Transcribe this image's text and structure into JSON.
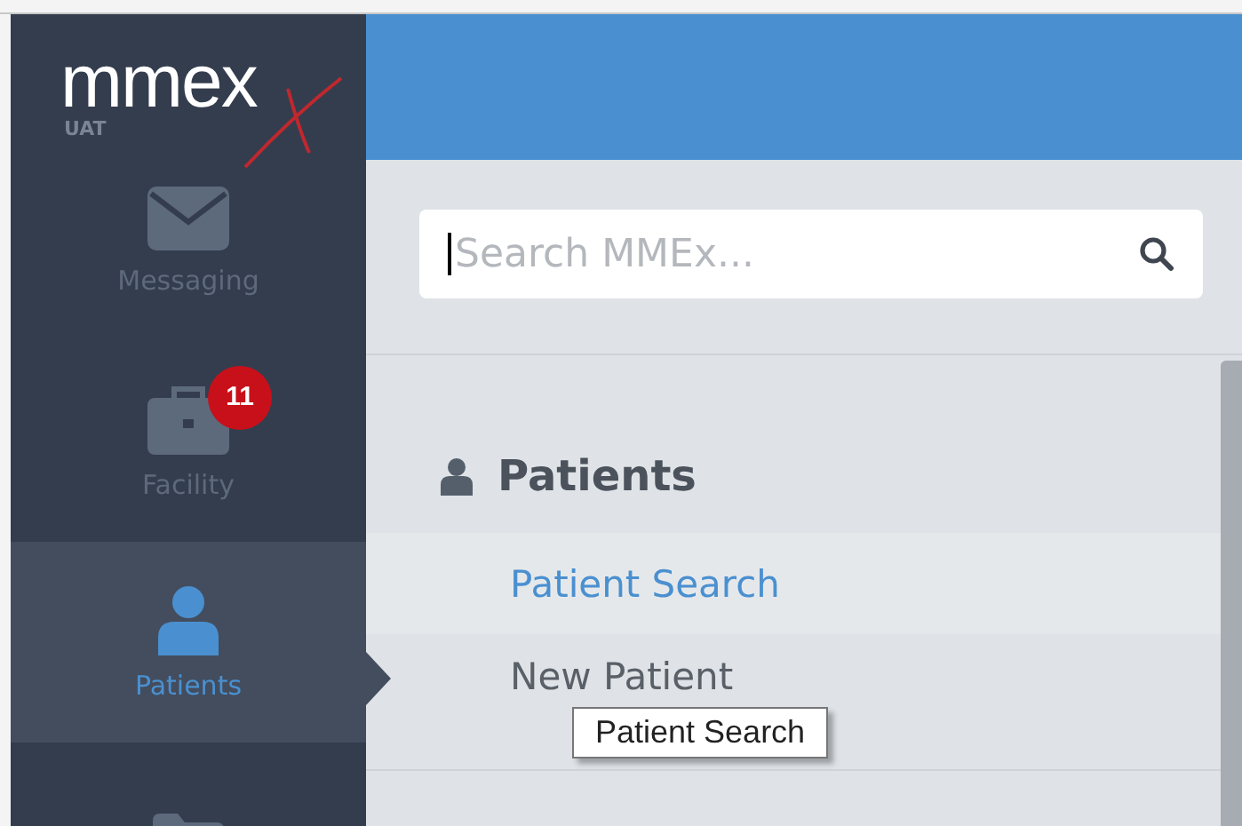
{
  "logo": {
    "name": "mmex",
    "environment": "UAT"
  },
  "nav": [
    {
      "label": "Messaging",
      "selected": false
    },
    {
      "label": "Facility",
      "selected": false,
      "badge": "11"
    },
    {
      "label": "Patients",
      "selected": true
    },
    {
      "selected": false
    }
  ],
  "search": {
    "placeholder": "Search MMEx..."
  },
  "section": {
    "title": "Patients",
    "items": [
      {
        "label": "Patient Search",
        "selected": true
      },
      {
        "label": "New Patient",
        "selected": false
      }
    ]
  },
  "tooltip": "Patient Search"
}
